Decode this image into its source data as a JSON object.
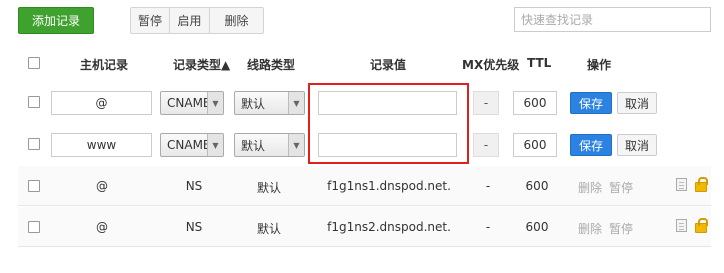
{
  "toolbar": {
    "add_label": "添加记录",
    "pause_label": "暂停",
    "enable_label": "启用",
    "delete_label": "删除",
    "search_placeholder": "快速查找记录"
  },
  "columns": {
    "host": "主机记录",
    "type": "记录类型▲",
    "line": "线路类型",
    "value": "记录值",
    "mx": "MX优先级",
    "ttl": "TTL",
    "ops": "操作"
  },
  "edit_rows": [
    {
      "host": "@",
      "type": "CNAME",
      "line": "默认",
      "value": "",
      "mx": "-",
      "ttl": "600",
      "save": "保存",
      "cancel": "取消"
    },
    {
      "host": "www",
      "type": "CNAME",
      "line": "默认",
      "value": "",
      "mx": "-",
      "ttl": "600",
      "save": "保存",
      "cancel": "取消"
    }
  ],
  "records": [
    {
      "host": "@",
      "type": "NS",
      "line": "默认",
      "value": "f1g1ns1.dnspod.net.",
      "mx": "-",
      "ttl": "600",
      "delete": "删除",
      "pause": "暂停"
    },
    {
      "host": "@",
      "type": "NS",
      "line": "默认",
      "value": "f1g1ns2.dnspod.net.",
      "mx": "-",
      "ttl": "600",
      "delete": "删除",
      "pause": "暂停"
    }
  ],
  "icons": {
    "remark": "note-icon",
    "lock": "lock-icon"
  },
  "colors": {
    "add_button": "#3fa22e",
    "save_button": "#2c82e0",
    "highlight": "#e0201e",
    "lock": "#f2b800"
  }
}
